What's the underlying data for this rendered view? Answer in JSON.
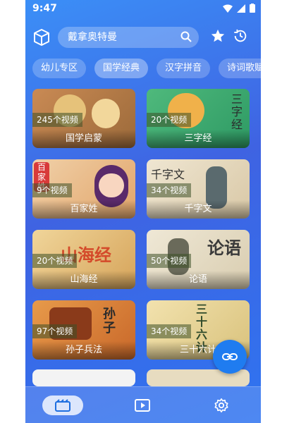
{
  "status": {
    "time": "9:47"
  },
  "search": {
    "query": "戴拿奥特曼"
  },
  "tabs": [
    "幼儿专区",
    "国学经典",
    "汉字拼音",
    "诗词歌赋"
  ],
  "active_tab": 1,
  "cards": [
    {
      "count": "245个视频",
      "title": "国学启蒙",
      "color": "#c98a54",
      "accent": "#e6c27a"
    },
    {
      "count": "20个视频",
      "title": "三字经",
      "color": "#4fb97c",
      "accent": "#f0b14a",
      "art_text": "三字经"
    },
    {
      "count": "9个视频",
      "title": "百家姓",
      "color": "#e7b98b",
      "accent": "#d83a3a",
      "art_text": "百家姓"
    },
    {
      "count": "34个视频",
      "title": "千字文",
      "color": "#e9dcc2",
      "accent": "#5a6a6e",
      "art_text": "千字文"
    },
    {
      "count": "20个视频",
      "title": "山海经",
      "color": "#e7c27c",
      "accent": "#d44a2a",
      "art_text": "山海经"
    },
    {
      "count": "50个视频",
      "title": "论语",
      "color": "#e8dfc8",
      "accent": "#3a3a3a",
      "art_text": "论语"
    },
    {
      "count": "97个视频",
      "title": "孙子兵法",
      "color": "#d97a2a",
      "accent": "#f4d55a",
      "art_text": "孙子"
    },
    {
      "count": "34个视频",
      "title": "三十六计",
      "color": "#e9d59a",
      "accent": "#2e4a2a",
      "art_text": "三十六计"
    }
  ],
  "bottom_nav": [
    {
      "name": "video-list",
      "icon": "film-icon",
      "active": true
    },
    {
      "name": "player",
      "icon": "play-icon",
      "active": false
    },
    {
      "name": "settings",
      "icon": "gear-icon",
      "active": false
    }
  ]
}
